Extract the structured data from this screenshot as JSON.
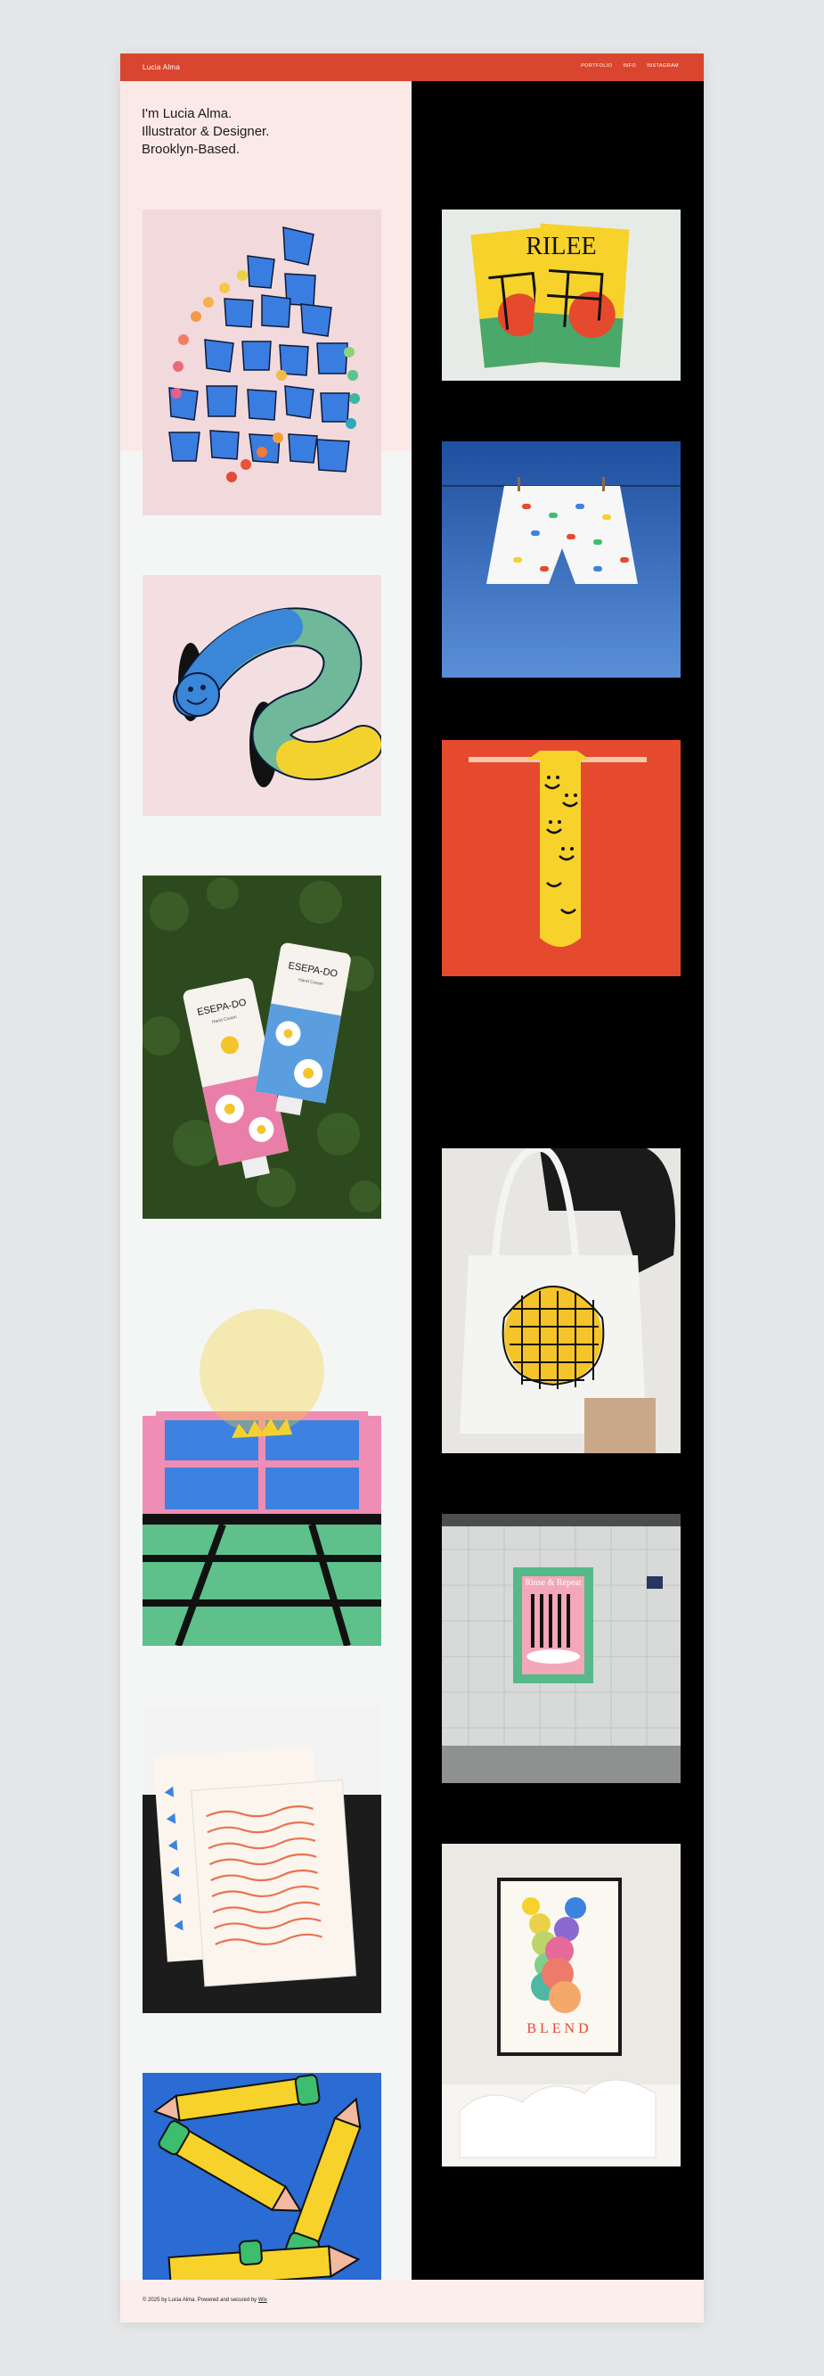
{
  "header": {
    "brand": "Lucia Alma",
    "nav": [
      "PORTFOLIO",
      "INFO",
      "INSTAGRAM"
    ]
  },
  "intro": {
    "lines": [
      "I'm Lucia Alma.",
      "Illustrator & Designer.",
      "Brooklyn-Based."
    ]
  },
  "portfolio": {
    "left": [
      {
        "name": "stacked-cups"
      },
      {
        "name": "smiley-worm"
      },
      {
        "name": "hand-cream-tubes",
        "brand_text": "ESEPA-DO",
        "sub_text": "Hand Cream"
      },
      {
        "name": "sun-window"
      },
      {
        "name": "wave-prints"
      },
      {
        "name": "pencils"
      }
    ],
    "right": [
      {
        "name": "rilee-zine",
        "title_text": "RILEE"
      },
      {
        "name": "boxer-shorts"
      },
      {
        "name": "smiley-drip"
      },
      {
        "name": "tote-bag"
      },
      {
        "name": "subway-poster",
        "title_text": "Rinse & Repeat"
      },
      {
        "name": "blend-poster",
        "title_text": "BLEND"
      }
    ]
  },
  "footer": {
    "text": "© 2025 by Lucia Alma. Powered and secured by ",
    "link": "Wix"
  },
  "colors": {
    "accent": "#d9452e",
    "pink_bg": "#fbe9e8",
    "black": "#000000",
    "blue": "#2f7ad6"
  }
}
